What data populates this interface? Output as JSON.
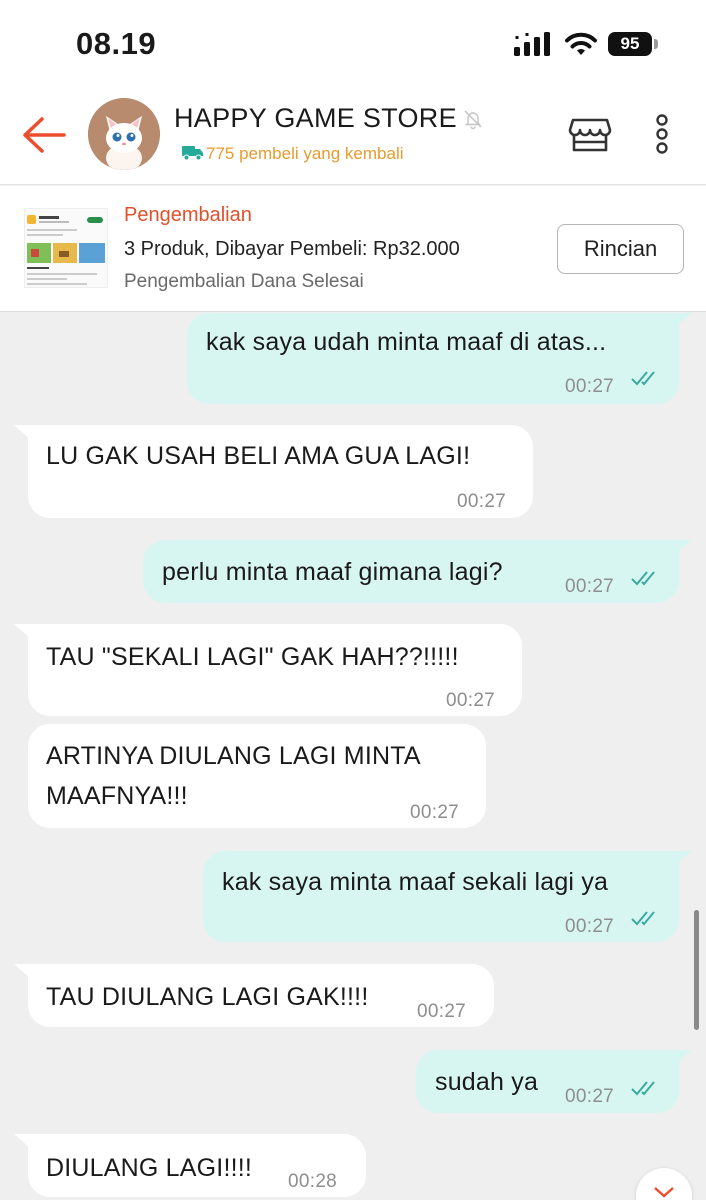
{
  "status_bar": {
    "time": "08.19",
    "battery": "95"
  },
  "header": {
    "store_name": "HAPPY GAME STORE",
    "subtitle": "775 pembeli yang kembali"
  },
  "order": {
    "type": "Pengembalian",
    "summary": "3 Produk, Dibayar Pembeli: Rp32.000",
    "status": "Pengembalian Dana Selesai",
    "detail_button": "Rincian"
  },
  "messages": [
    {
      "direction": "out",
      "lines": [
        "kak saya udah minta maaf di atas..."
      ],
      "time": "00:27"
    },
    {
      "direction": "in",
      "lines": [
        "LU GAK USAH BELI AMA GUA LAGI!"
      ],
      "time": "00:27"
    },
    {
      "direction": "out",
      "lines": [
        "perlu minta maaf gimana lagi?"
      ],
      "time": "00:27"
    },
    {
      "direction": "in",
      "lines": [
        "TAU \"SEKALI LAGI\" GAK HAH??!!!!!"
      ],
      "time": "00:27"
    },
    {
      "direction": "in",
      "lines": [
        "ARTINYA DIULANG LAGI MINTA",
        "MAAFNYA!!!"
      ],
      "time": "00:27"
    },
    {
      "direction": "out",
      "lines": [
        "kak saya minta maaf sekali lagi ya"
      ],
      "time": "00:27"
    },
    {
      "direction": "in",
      "lines": [
        "TAU DIULANG LAGI GAK!!!!"
      ],
      "time": "00:27"
    },
    {
      "direction": "out",
      "lines": [
        "sudah ya"
      ],
      "time": "00:27"
    },
    {
      "direction": "in",
      "lines": [
        "DIULANG LAGI!!!!"
      ],
      "time": "00:28"
    }
  ],
  "colors": {
    "accent": "#ee4d2d",
    "outgoing_bubble": "#d8f6f1",
    "incoming_bubble": "#ffffff",
    "read_check": "#3aa9a0",
    "subtitle": "#e89b2e"
  }
}
